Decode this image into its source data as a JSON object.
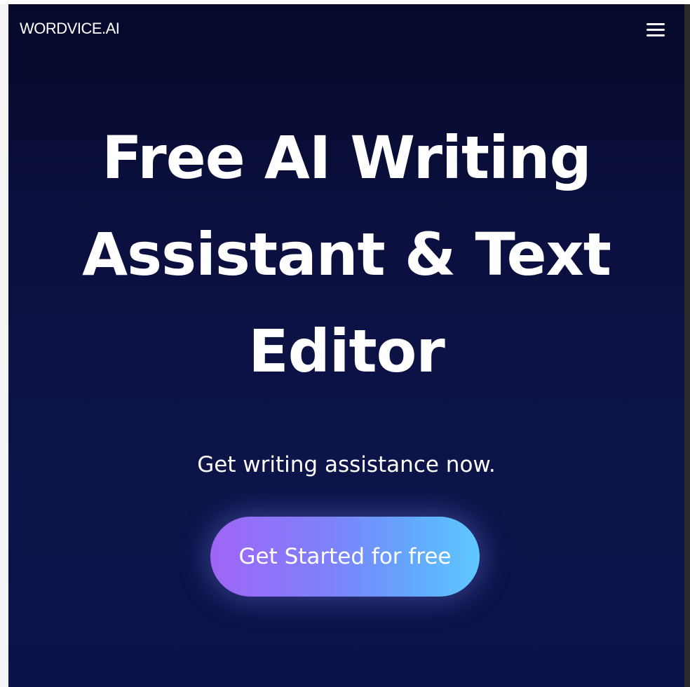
{
  "header": {
    "logo_text": "WORDVICE.AI",
    "menu_icon": "hamburger-menu-icon"
  },
  "hero": {
    "title_lines": [
      "Free AI Writing",
      "Assistant & Text",
      "Editor"
    ],
    "subtitle": "Get writing assistance now.",
    "cta_label": "Get Started for free"
  },
  "colors": {
    "background_top": "#06092a",
    "background_bottom": "#0b124a",
    "cta_gradient_start": "#a065f5",
    "cta_gradient_end": "#5fc8fe",
    "text": "#ffffff"
  }
}
